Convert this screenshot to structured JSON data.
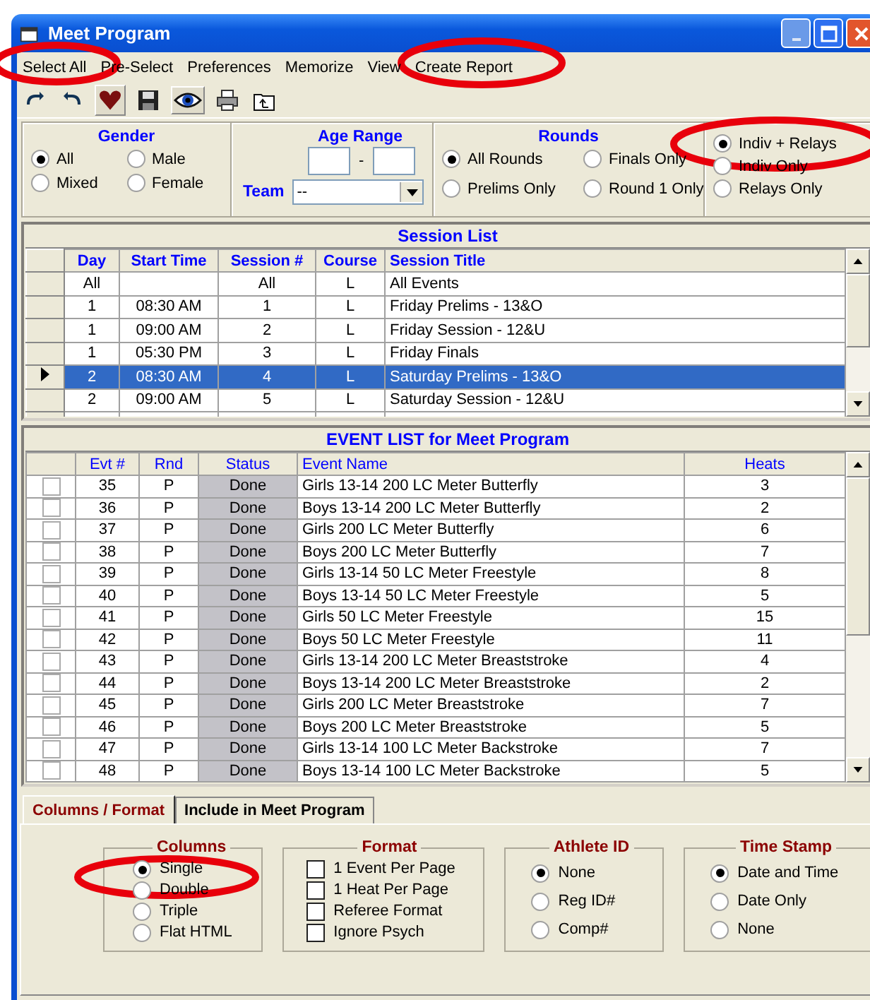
{
  "window": {
    "title": "Meet Program"
  },
  "menu": [
    "Select All",
    "Pre-Select",
    "Preferences",
    "Memorize",
    "View",
    "Create Report"
  ],
  "filters": {
    "gender": {
      "title": "Gender",
      "options": [
        {
          "label": "All",
          "selected": true
        },
        {
          "label": "Male",
          "selected": false
        },
        {
          "label": "Mixed",
          "selected": false
        },
        {
          "label": "Female",
          "selected": false
        }
      ]
    },
    "age_range": {
      "title": "Age Range",
      "separator": "-"
    },
    "team": {
      "label": "Team",
      "value": "--"
    },
    "rounds": {
      "title": "Rounds",
      "options": [
        {
          "label": "All Rounds",
          "selected": true
        },
        {
          "label": "Finals Only",
          "selected": false
        },
        {
          "label": "Prelims Only",
          "selected": false
        },
        {
          "label": "Round 1 Only",
          "selected": false
        }
      ]
    },
    "event_type": {
      "options": [
        {
          "label": "Indiv + Relays",
          "selected": true
        },
        {
          "label": "Indiv Only",
          "selected": false
        },
        {
          "label": "Relays Only",
          "selected": false
        }
      ]
    }
  },
  "session_list": {
    "title": "Session List",
    "columns": [
      "Day",
      "Start Time",
      "Session #",
      "Course",
      "Session Title"
    ],
    "rows": [
      {
        "cells": [
          "All",
          "",
          "All",
          "L",
          "All Events"
        ],
        "selected": false
      },
      {
        "cells": [
          "1",
          "08:30 AM",
          "1",
          "L",
          "Friday Prelims - 13&O"
        ],
        "selected": false
      },
      {
        "cells": [
          "1",
          "09:00 AM",
          "2",
          "L",
          "Friday Session - 12&U"
        ],
        "selected": false
      },
      {
        "cells": [
          "1",
          "05:30 PM",
          "3",
          "L",
          "Friday Finals"
        ],
        "selected": false
      },
      {
        "cells": [
          "2",
          "08:30 AM",
          "4",
          "L",
          "Saturday Prelims - 13&O"
        ],
        "selected": true
      },
      {
        "cells": [
          "2",
          "09:00 AM",
          "5",
          "L",
          "Saturday Session - 12&U"
        ],
        "selected": false
      }
    ]
  },
  "event_list": {
    "title": "EVENT LIST for Meet Program",
    "columns": [
      "Evt #",
      "Rnd",
      "Status",
      "Event Name",
      "Heats"
    ],
    "rows": [
      {
        "checked": false,
        "evt": "35",
        "rnd": "P",
        "status": "Done",
        "name": "Girls 13-14 200 LC Meter Butterfly",
        "heats": "3"
      },
      {
        "checked": false,
        "evt": "36",
        "rnd": "P",
        "status": "Done",
        "name": "Boys 13-14 200 LC Meter Butterfly",
        "heats": "2"
      },
      {
        "checked": false,
        "evt": "37",
        "rnd": "P",
        "status": "Done",
        "name": "Girls 200 LC Meter Butterfly",
        "heats": "6"
      },
      {
        "checked": false,
        "evt": "38",
        "rnd": "P",
        "status": "Done",
        "name": "Boys 200 LC Meter Butterfly",
        "heats": "7"
      },
      {
        "checked": false,
        "evt": "39",
        "rnd": "P",
        "status": "Done",
        "name": "Girls 13-14 50 LC Meter Freestyle",
        "heats": "8"
      },
      {
        "checked": false,
        "evt": "40",
        "rnd": "P",
        "status": "Done",
        "name": "Boys 13-14 50 LC Meter Freestyle",
        "heats": "5"
      },
      {
        "checked": false,
        "evt": "41",
        "rnd": "P",
        "status": "Done",
        "name": "Girls 50 LC Meter Freestyle",
        "heats": "15"
      },
      {
        "checked": false,
        "evt": "42",
        "rnd": "P",
        "status": "Done",
        "name": "Boys 50 LC Meter Freestyle",
        "heats": "11"
      },
      {
        "checked": false,
        "evt": "43",
        "rnd": "P",
        "status": "Done",
        "name": "Girls 13-14 200 LC Meter Breaststroke",
        "heats": "4"
      },
      {
        "checked": false,
        "evt": "44",
        "rnd": "P",
        "status": "Done",
        "name": "Boys 13-14 200 LC Meter Breaststroke",
        "heats": "2"
      },
      {
        "checked": false,
        "evt": "45",
        "rnd": "P",
        "status": "Done",
        "name": "Girls 200 LC Meter Breaststroke",
        "heats": "7"
      },
      {
        "checked": false,
        "evt": "46",
        "rnd": "P",
        "status": "Done",
        "name": "Boys 200 LC Meter Breaststroke",
        "heats": "5"
      },
      {
        "checked": false,
        "evt": "47",
        "rnd": "P",
        "status": "Done",
        "name": "Girls 13-14 100 LC Meter Backstroke",
        "heats": "7"
      },
      {
        "checked": false,
        "evt": "48",
        "rnd": "P",
        "status": "Done",
        "name": "Boys 13-14 100 LC Meter Backstroke",
        "heats": "5"
      }
    ]
  },
  "tabs": [
    {
      "label": "Columns / Format",
      "selected": true
    },
    {
      "label": "Include in Meet Program",
      "selected": false
    }
  ],
  "options": {
    "columns": {
      "title": "Columns",
      "options": [
        {
          "label": "Single",
          "selected": true
        },
        {
          "label": "Double",
          "selected": false
        },
        {
          "label": "Triple",
          "selected": false
        },
        {
          "label": "Flat HTML",
          "selected": false
        }
      ]
    },
    "format": {
      "title": "Format",
      "options": [
        {
          "label": "1 Event Per Page",
          "checked": false
        },
        {
          "label": "1 Heat Per Page",
          "checked": false
        },
        {
          "label": "Referee Format",
          "checked": false
        },
        {
          "label": "Ignore Psych",
          "checked": false
        }
      ]
    },
    "athlete_id": {
      "title": "Athlete ID",
      "options": [
        {
          "label": "None",
          "selected": true
        },
        {
          "label": "Reg ID#",
          "selected": false
        },
        {
          "label": "Comp#",
          "selected": false
        }
      ]
    },
    "time_stamp": {
      "title": "Time Stamp",
      "options": [
        {
          "label": "Date and Time",
          "selected": true
        },
        {
          "label": "Date Only",
          "selected": false
        },
        {
          "label": "None",
          "selected": false
        }
      ]
    }
  }
}
